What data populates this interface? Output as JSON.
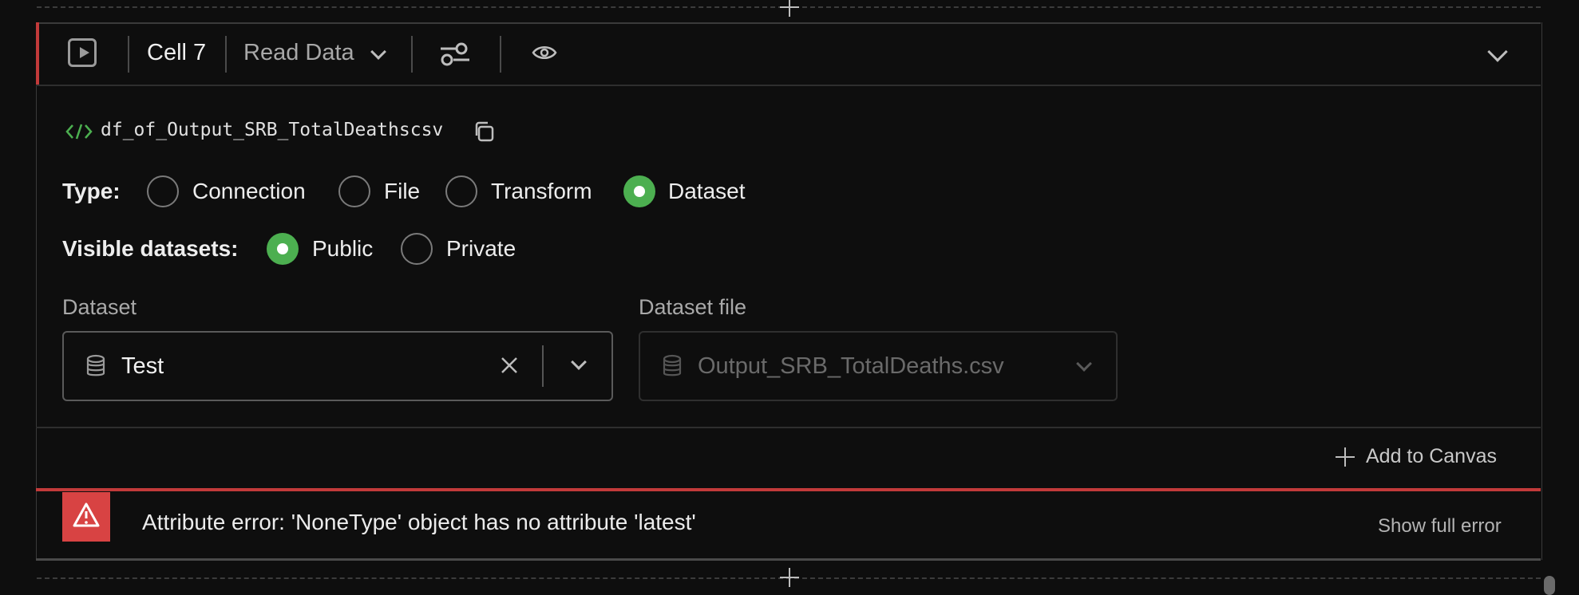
{
  "cell": {
    "title": "Cell 7",
    "type_dropdown": "Read Data",
    "variable_name": "df_of_Output_SRB_TotalDeathscsv"
  },
  "type_row": {
    "label": "Type:",
    "options": [
      "Connection",
      "File",
      "Transform",
      "Dataset"
    ],
    "selected": "Dataset"
  },
  "visibility_row": {
    "label": "Visible datasets:",
    "options": [
      "Public",
      "Private"
    ],
    "selected": "Public"
  },
  "dataset": {
    "label": "Dataset",
    "value": "Test"
  },
  "dataset_file": {
    "label": "Dataset file",
    "value": "Output_SRB_TotalDeaths.csv"
  },
  "actions": {
    "add_to_canvas": "Add to Canvas"
  },
  "error": {
    "message": "Attribute error: 'NoneType' object has no attribute 'latest'",
    "show_full": "Show full error"
  },
  "colors": {
    "accent_green": "#4caf50",
    "error_red": "#d84343",
    "background": "#0e0e0e"
  }
}
